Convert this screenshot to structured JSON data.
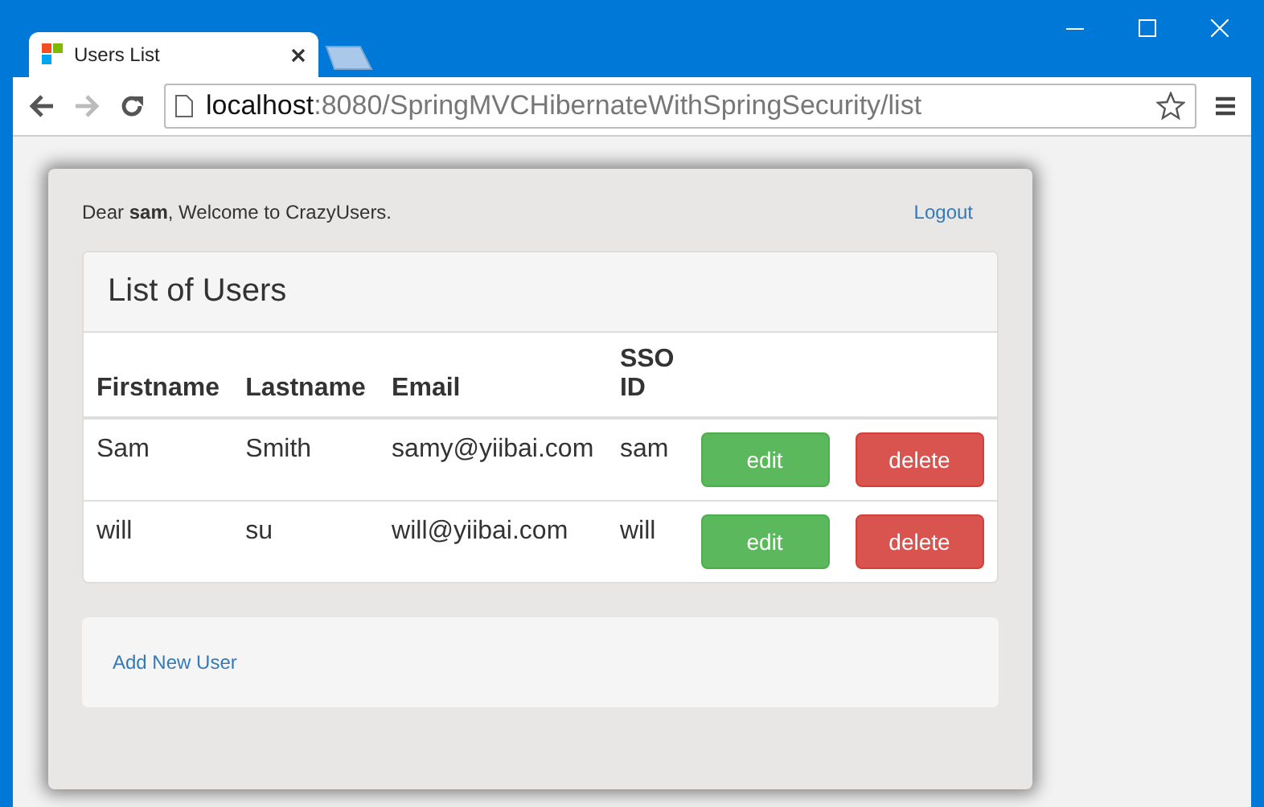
{
  "tab": {
    "title": "Users List"
  },
  "address": {
    "host": "localhost",
    "path": ":8080/SpringMVCHibernateWithSpringSecurity/list"
  },
  "header": {
    "welcome": "Dear **sam**, Welcome to CrazyUsers.",
    "logout": "Logout"
  },
  "panel": {
    "title": "List of Users"
  },
  "table": {
    "columns": [
      "Firstname",
      "Lastname",
      "Email",
      "SSO ID"
    ],
    "rows": [
      {
        "cells": [
          "Sam",
          "Smith",
          "samy@yiibai.com",
          "sam"
        ],
        "actions": [
          {
            "kind": "edit",
            "label": "edit"
          },
          {
            "kind": "delete",
            "label": "delete"
          }
        ]
      },
      {
        "cells": [
          "will",
          "su",
          "will@yiibai.com",
          "will"
        ],
        "actions": [
          {
            "kind": "edit",
            "label": "edit"
          },
          {
            "kind": "delete",
            "label": "delete"
          }
        ]
      }
    ]
  },
  "footer": {
    "link": "Add New User"
  }
}
